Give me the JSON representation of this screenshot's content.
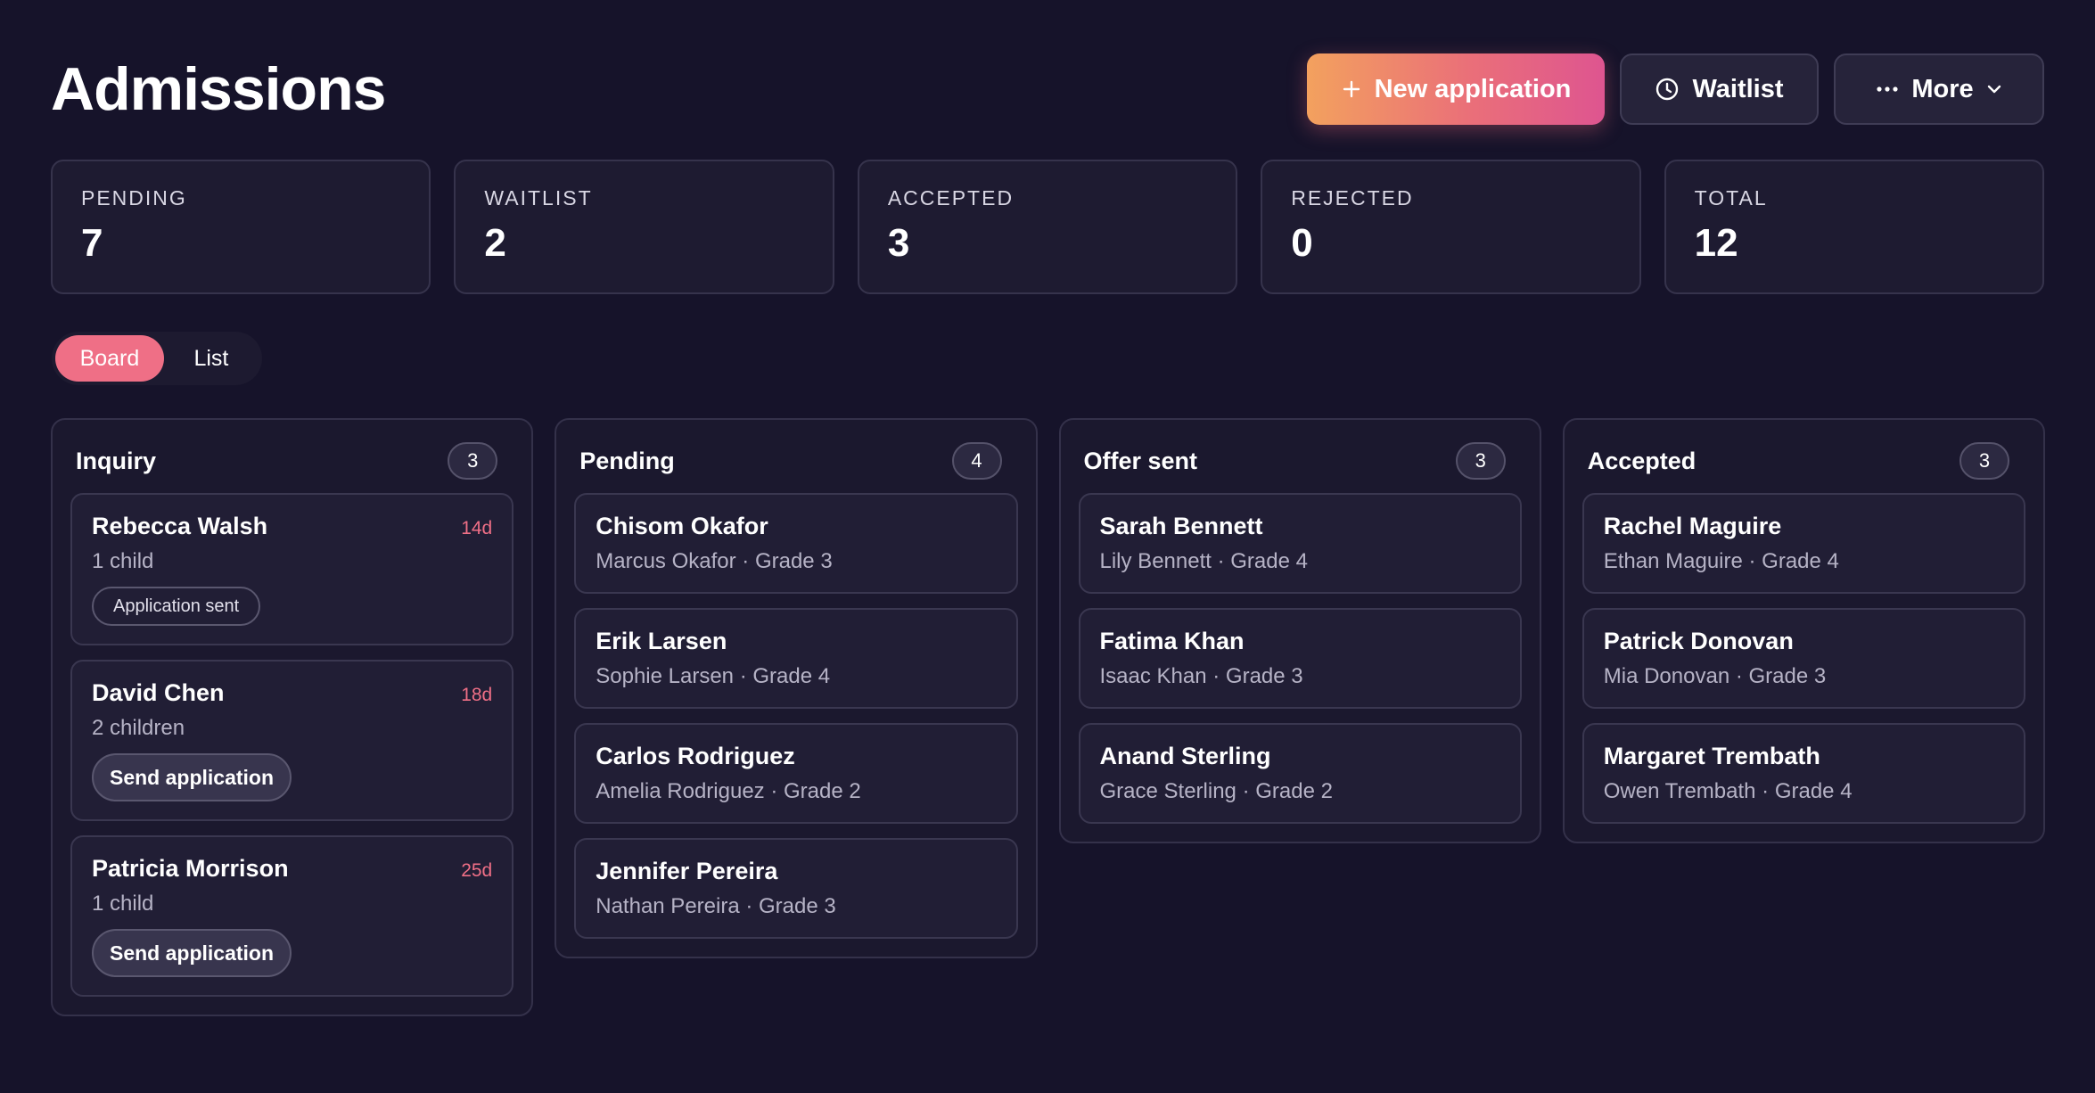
{
  "header": {
    "title": "Admissions",
    "new_application_label": "New application",
    "waitlist_label": "Waitlist",
    "more_label": "More"
  },
  "stats": [
    {
      "label": "PENDING",
      "value": "7"
    },
    {
      "label": "WAITLIST",
      "value": "2"
    },
    {
      "label": "ACCEPTED",
      "value": "3"
    },
    {
      "label": "REJECTED",
      "value": "0"
    },
    {
      "label": "TOTAL",
      "value": "12"
    }
  ],
  "view_toggle": {
    "board_label": "Board",
    "list_label": "List",
    "active": "Board"
  },
  "colors": {
    "accent": "#ef6f86",
    "gradient_start": "#f3a15e",
    "gradient_end": "#de5590",
    "background": "#16132a"
  },
  "columns": [
    {
      "title": "Inquiry",
      "count": "3",
      "cards": [
        {
          "name": "Rebecca Walsh",
          "age": "14d",
          "sub": "1 child",
          "chip": "Application sent"
        },
        {
          "name": "David Chen",
          "age": "18d",
          "sub": "2 children",
          "action": "Send application"
        },
        {
          "name": "Patricia Morrison",
          "age": "25d",
          "sub": "1 child",
          "action": "Send application"
        }
      ]
    },
    {
      "title": "Pending",
      "count": "4",
      "cards": [
        {
          "name": "Chisom Okafor",
          "sub": "Marcus Okafor · Grade 3"
        },
        {
          "name": "Erik Larsen",
          "sub": "Sophie Larsen · Grade 4"
        },
        {
          "name": "Carlos Rodriguez",
          "sub": "Amelia Rodriguez · Grade 2"
        },
        {
          "name": "Jennifer Pereira",
          "sub": "Nathan Pereira · Grade 3"
        }
      ]
    },
    {
      "title": "Offer sent",
      "count": "3",
      "cards": [
        {
          "name": "Sarah Bennett",
          "sub": "Lily Bennett · Grade 4"
        },
        {
          "name": "Fatima Khan",
          "sub": "Isaac Khan · Grade 3"
        },
        {
          "name": "Anand Sterling",
          "sub": "Grace Sterling · Grade 2"
        }
      ]
    },
    {
      "title": "Accepted",
      "count": "3",
      "cards": [
        {
          "name": "Rachel Maguire",
          "sub": "Ethan Maguire · Grade 4"
        },
        {
          "name": "Patrick Donovan",
          "sub": "Mia Donovan · Grade 3"
        },
        {
          "name": "Margaret Trembath",
          "sub": "Owen Trembath · Grade 4"
        }
      ]
    }
  ]
}
